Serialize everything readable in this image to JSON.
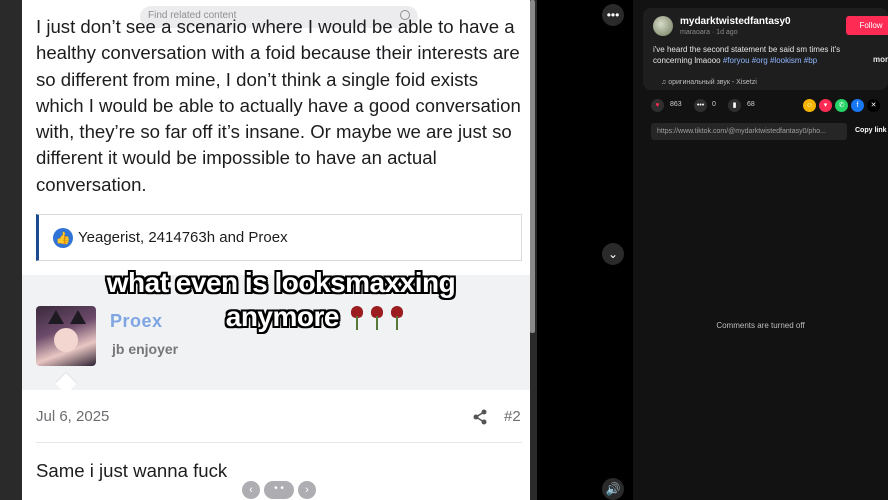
{
  "post": {
    "text": "I just don’t see a scenario where I would be able to have a healthy conversation with a foid because their interests are so different from mine, I don’t think a single foid exists which I would be able to actually have a good conversation with, they’re so far off it’s insane. Or maybe we are just so different it would be impossible to have an actual conversation.",
    "reactions": "Yeagerist, 2414763h and Proex",
    "find_placeholder": "Find related content"
  },
  "author": {
    "name": "Proex",
    "title": "jb enjoyer"
  },
  "reply": {
    "date": "Jul 6, 2025",
    "post_number": "#2",
    "text": "Same i just wanna fuck"
  },
  "caption": {
    "line1": "what even is looksmaxxing",
    "line2": "anymore"
  },
  "controls": {
    "more": "•••",
    "next": "⌄",
    "volume": "🔊",
    "carousel_prev": "‹",
    "carousel_dots": "• •",
    "carousel_next": "›"
  },
  "panel": {
    "username": "mydarktwistedfantasy0",
    "subline": "maraoara · 1d ago",
    "follow": "Follow",
    "desc_text": "i've heard the second statement be said sm times it's concerning lmaooo ",
    "hashtags": "#foryou #org #lookism #bp",
    "more": "more",
    "sound": "♫ оригинальный звук - Xisetzi",
    "likes": "863",
    "comments": "0",
    "saves": "68",
    "link": "https://www.tiktok.com/@mydarktwistedfantasy0/pho...",
    "copy_link": "Copy link",
    "comments_off": "Comments are turned off",
    "colors": {
      "follow": "#fe2c55",
      "like": "#fe2c55",
      "hashtag": "#8fb6ff"
    }
  },
  "icons": [
    "heart-icon",
    "comment-icon",
    "bookmark-icon",
    "whatsapp-icon",
    "facebook-icon",
    "x-icon",
    "share-icon",
    "like-icon"
  ]
}
